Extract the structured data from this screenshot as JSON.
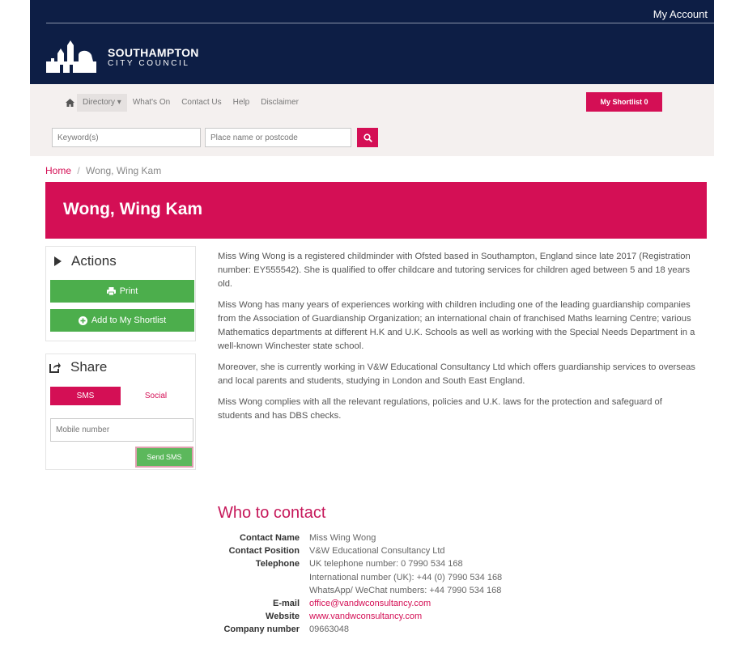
{
  "header": {
    "my_account": "My Account",
    "logo_line1": "SOUTHAMPTON",
    "logo_line2": "CITY COUNCIL"
  },
  "nav": {
    "items": [
      "Directory ▾",
      "What's On",
      "Contact Us",
      "Help",
      "Disclaimer"
    ],
    "shortlist_label": "My Shortlist 0"
  },
  "search": {
    "keyword_placeholder": "Keyword(s)",
    "place_placeholder": "Place name or postcode"
  },
  "breadcrumb": {
    "home": "Home",
    "separator": "/",
    "current": "Wong, Wing Kam"
  },
  "page": {
    "title": "Wong, Wing Kam"
  },
  "actions": {
    "title": "Actions",
    "print_label": "Print",
    "add_label": "Add to My Shortlist"
  },
  "share": {
    "title": "Share",
    "tab_sms": "SMS",
    "tab_social": "Social",
    "mobile_placeholder": "Mobile number",
    "send_label": "Send SMS"
  },
  "description": [
    "Miss Wing Wong is a registered childminder with Ofsted based in Southampton, England since late 2017 (Registration number: EY555542).  She is qualified to offer childcare and tutoring services for children aged between 5 and 18 years old.",
    "Miss Wong has many years of experiences working with children including one of the leading guardianship companies from the Association of Guardianship Organization; an international chain of franchised Maths learning Centre; various Mathematics departments at different H.K and U.K. Schools as well as working with the Special Needs Department in a well-known Winchester state school.",
    "Moreover, she is currently working in V&W Educational Consultancy Ltd which offers guardianship services to overseas and local parents and students, studying in London and South East England.",
    "Miss Wong complies with all the relevant regulations, policies and U.K. laws for the protection and safeguard of students and has DBS checks."
  ],
  "contact": {
    "heading": "Who to contact",
    "name_label": "Contact Name",
    "name": "Miss Wing Wong",
    "position_label": "Contact Position",
    "position": "V&W Educational Consultancy Ltd",
    "telephone_label": "Telephone",
    "telephone_lines": [
      "UK telephone number: 0 7990 534 168",
      "International number (UK): +44 (0) 7990 534 168",
      "WhatsApp/ WeChat numbers: +44 7990 534 168"
    ],
    "email_label": "E-mail",
    "email": "office@vandwconsultancy.com",
    "website_label": "Website",
    "website": "www.vandwconsultancy.com",
    "company_label": "Company number",
    "company_number": "09663048"
  },
  "colors": {
    "navy": "#0d1e45",
    "brand_pink": "#d40f55",
    "green": "#4cae4c"
  }
}
